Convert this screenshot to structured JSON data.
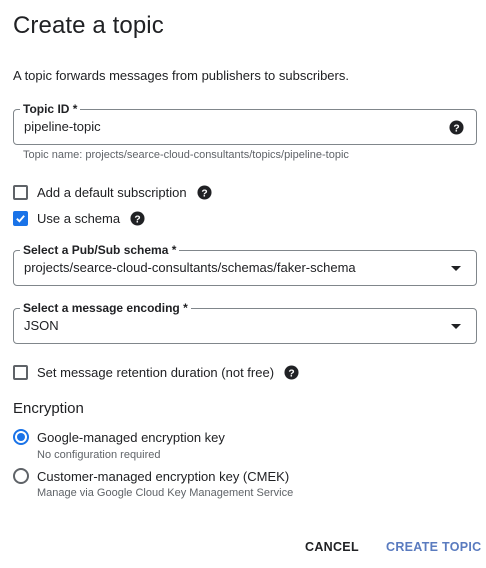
{
  "page": {
    "title": "Create a topic",
    "description": "A topic forwards messages from publishers to subscribers."
  },
  "topic_id": {
    "label": "Topic ID *",
    "value": "pipeline-topic",
    "hint": "Topic name: projects/searce-cloud-consultants/topics/pipeline-topic"
  },
  "options": {
    "default_subscription": {
      "label": "Add a default subscription",
      "checked": false
    },
    "use_schema": {
      "label": "Use a schema",
      "checked": true
    },
    "retention": {
      "label": "Set message retention duration (not free)",
      "checked": false
    }
  },
  "schema_select": {
    "label": "Select a Pub/Sub schema *",
    "value": "projects/searce-cloud-consultants/schemas/faker-schema"
  },
  "encoding_select": {
    "label": "Select a message encoding *",
    "value": "JSON"
  },
  "encryption": {
    "title": "Encryption",
    "google": {
      "label": "Google-managed encryption key",
      "sub": "No configuration required",
      "selected": true
    },
    "customer": {
      "label": "Customer-managed encryption key (CMEK)",
      "sub": "Manage via Google Cloud Key Management Service",
      "selected": false
    }
  },
  "actions": {
    "cancel": "CANCEL",
    "create": "CREATE TOPIC"
  },
  "colors": {
    "accent": "#1a73e8",
    "primary_button_text": "#5a7bbf",
    "text": "#202124",
    "muted": "#5f6368"
  },
  "icons": {
    "help": "help-icon",
    "dropdown": "chevron-down-icon",
    "check": "check-icon"
  }
}
